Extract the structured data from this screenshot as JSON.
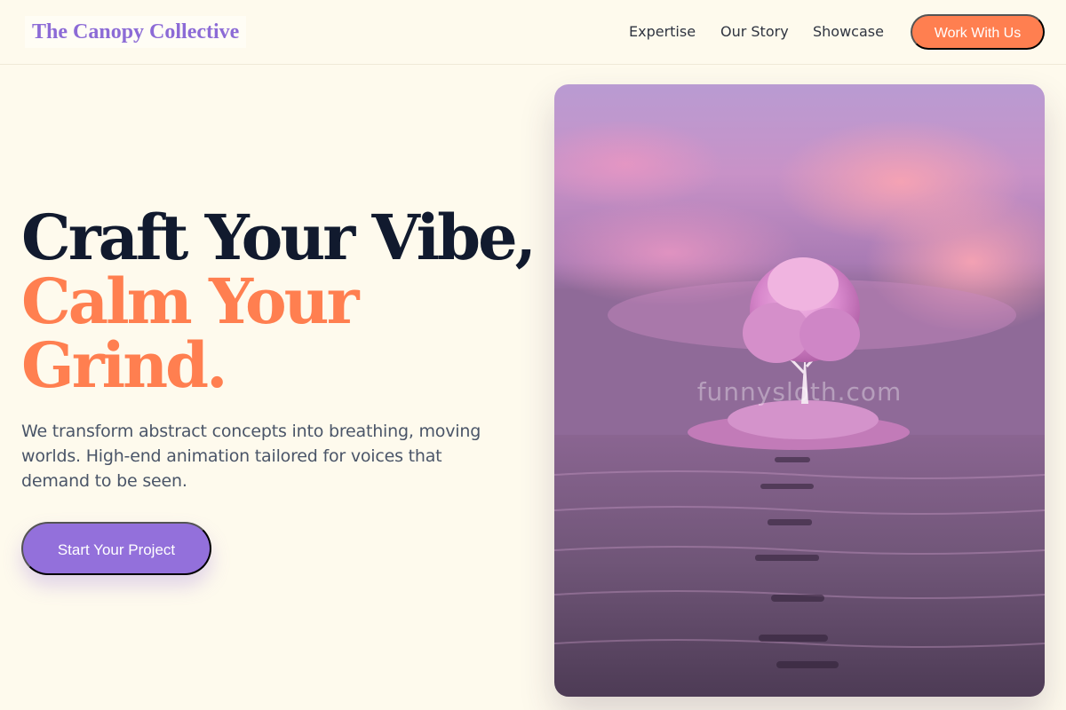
{
  "brand": {
    "name": "The Canopy Collective",
    "color": "#8c6bd6"
  },
  "nav": {
    "links": [
      "Expertise",
      "Our Story",
      "Showcase"
    ],
    "cta_label": "Work With Us"
  },
  "hero": {
    "headline_line1": "Craft Your Vibe,",
    "headline_line2": "Calm Your",
    "headline_line3": "Grind.",
    "lead": "We transform abstract concepts into breathing, moving worlds. High-end animation tailored for voices that demand to be seen.",
    "cta_label": "Start Your Project",
    "image": {
      "subject": "pink-tree-on-island-in-lake",
      "watermark": "funnysloth.com"
    }
  },
  "colors": {
    "background": "#fefaed",
    "accent": "#ff7f50",
    "primary": "#9370db",
    "heading": "#111a2e",
    "body_text": "#4a5568"
  }
}
